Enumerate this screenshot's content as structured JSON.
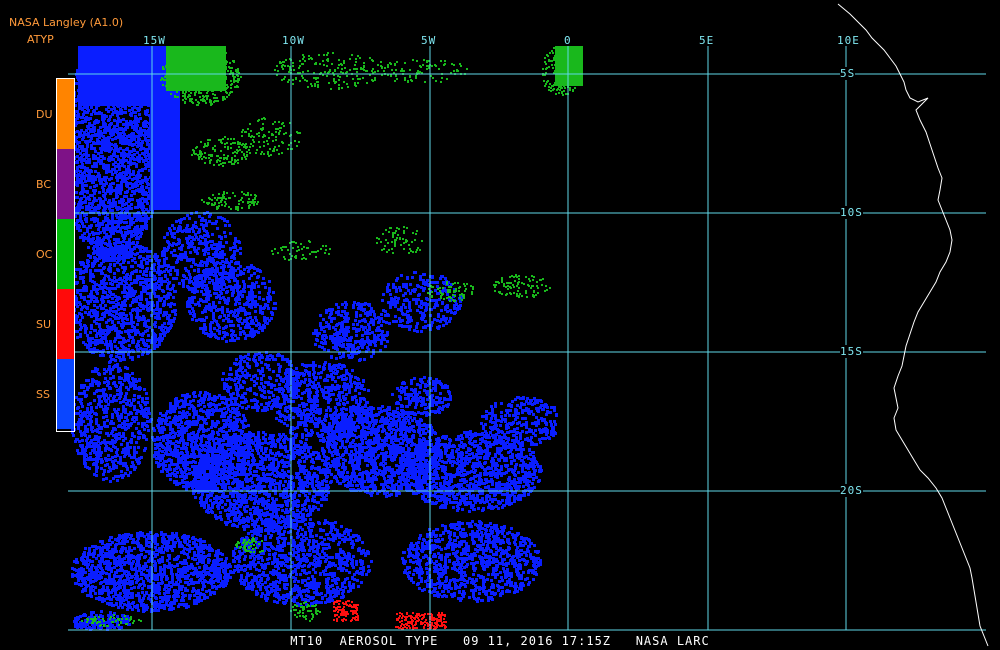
{
  "header": {
    "source": "NASA Langley (A1.0)",
    "product": "ATYP"
  },
  "legend": {
    "items": [
      {
        "label": "DU",
        "color": "#ff8400"
      },
      {
        "label": "BC",
        "color": "#7e1287"
      },
      {
        "label": "OC",
        "color": "#00b80a"
      },
      {
        "label": "SU",
        "color": "#ff0a0a"
      },
      {
        "label": "SS",
        "color": "#0a46ff"
      }
    ]
  },
  "axes": {
    "longitude_labels": [
      "15W",
      "10W",
      "5W",
      "0",
      "5E",
      "10E"
    ],
    "latitude_labels": [
      "5S",
      "10S",
      "15S",
      "20S"
    ],
    "grid_color": "#5fd8e8",
    "coast_color": "#ffffff"
  },
  "footer": {
    "text": "MT10  AEROSOL TYPE   09 11, 2016 17:15Z   NASA LARC"
  },
  "colors": {
    "background": "#000000",
    "sea_salt": "#0a1eff",
    "organic_carbon": "#19b81c",
    "sulfate": "#ff1010"
  }
}
